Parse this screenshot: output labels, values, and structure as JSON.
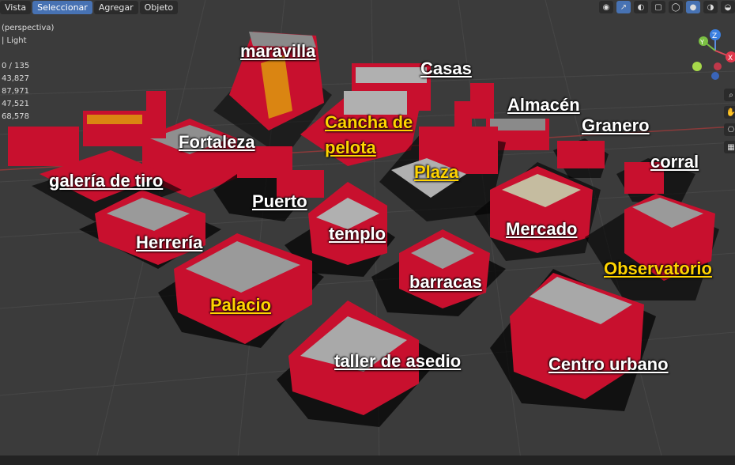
{
  "menubar": {
    "items": [
      "Vista",
      "Seleccionar",
      "Agregar",
      "Objeto"
    ],
    "active_index": 1
  },
  "viewport": {
    "mode_label": "(perspectiva)",
    "lighting_label": "| Light",
    "stats": [
      "0 / 135",
      "43,827",
      "87,971",
      "47,521",
      "68,578"
    ]
  },
  "gizmo": {
    "z": "Z",
    "y": "Y",
    "x": "X"
  },
  "labels": {
    "maravilla": "maravilla",
    "casas": "Casas",
    "almacen": "Almacén",
    "granero": "Granero",
    "cancha1": "Cancha de",
    "cancha2": "pelota",
    "fortaleza": "Fortaleza",
    "galeria": "galería de tiro",
    "plaza": "Plaza",
    "corral": "corral",
    "puerto": "Puerto",
    "templo": "templo",
    "mercado": "Mercado",
    "herreria": "Herrería",
    "observatorio": "Observatorio",
    "barracas": "barracas",
    "palacio": "Palacio",
    "taller": "taller de asedio",
    "centro": "Centro urbano"
  },
  "colors": {
    "building_red": "#c8102e",
    "roof_grey": "#9a9a9a",
    "label_yellow": "#ffd400",
    "accent_yellow": "#e6d400"
  }
}
